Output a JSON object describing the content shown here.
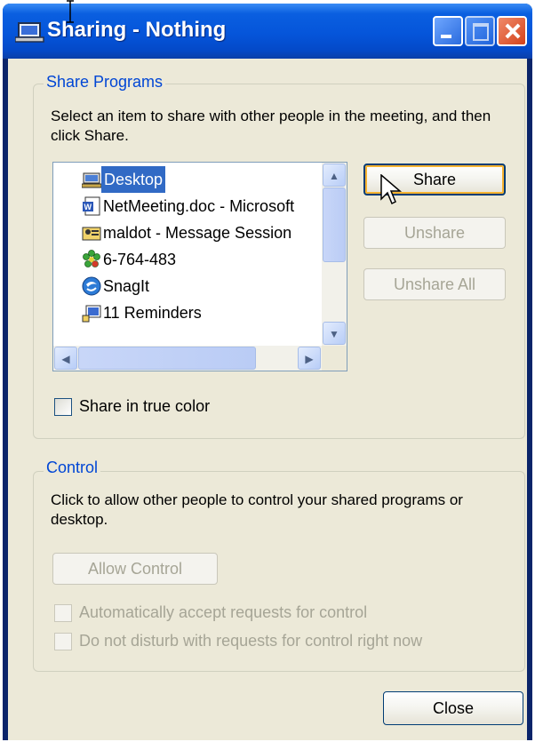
{
  "window": {
    "title": "Sharing - Nothing",
    "icons": {
      "title": "netmeeting-sharing-icon",
      "minimize": "minimize-icon",
      "maximize": "maximize-icon",
      "close": "close-icon"
    }
  },
  "share_programs": {
    "group_label": "Share Programs",
    "instructions": "Select an item to share with other people in the meeting, and then click Share.",
    "list_items": [
      {
        "label": "Desktop",
        "icon": "desktop-icon",
        "selected": true
      },
      {
        "label": "NetMeeting.doc - Microsoft",
        "icon": "word-document-icon",
        "selected": false
      },
      {
        "label": "maldot - Message Session",
        "icon": "message-session-icon",
        "selected": false
      },
      {
        "label": "6-764-483",
        "icon": "icq-flower-icon",
        "selected": false
      },
      {
        "label": "SnagIt",
        "icon": "snagit-icon",
        "selected": false
      },
      {
        "label": "11 Reminders",
        "icon": "reminders-icon",
        "selected": false
      }
    ],
    "buttons": {
      "share": "Share",
      "unshare": "Unshare",
      "unshare_all": "Unshare All"
    },
    "true_color_label": "Share in true color"
  },
  "control": {
    "group_label": "Control",
    "instructions": "Click to allow other people to control your shared programs or desktop.",
    "allow_control": "Allow Control",
    "auto_accept": "Automatically accept requests for control",
    "do_not_disturb": "Do not disturb with requests for control right now"
  },
  "footer": {
    "close": "Close"
  },
  "colors": {
    "title_bar": "#0555DA",
    "selection": "#316AC5",
    "group_title": "#0046D5",
    "dialog_bg": "#ECE9D8"
  }
}
